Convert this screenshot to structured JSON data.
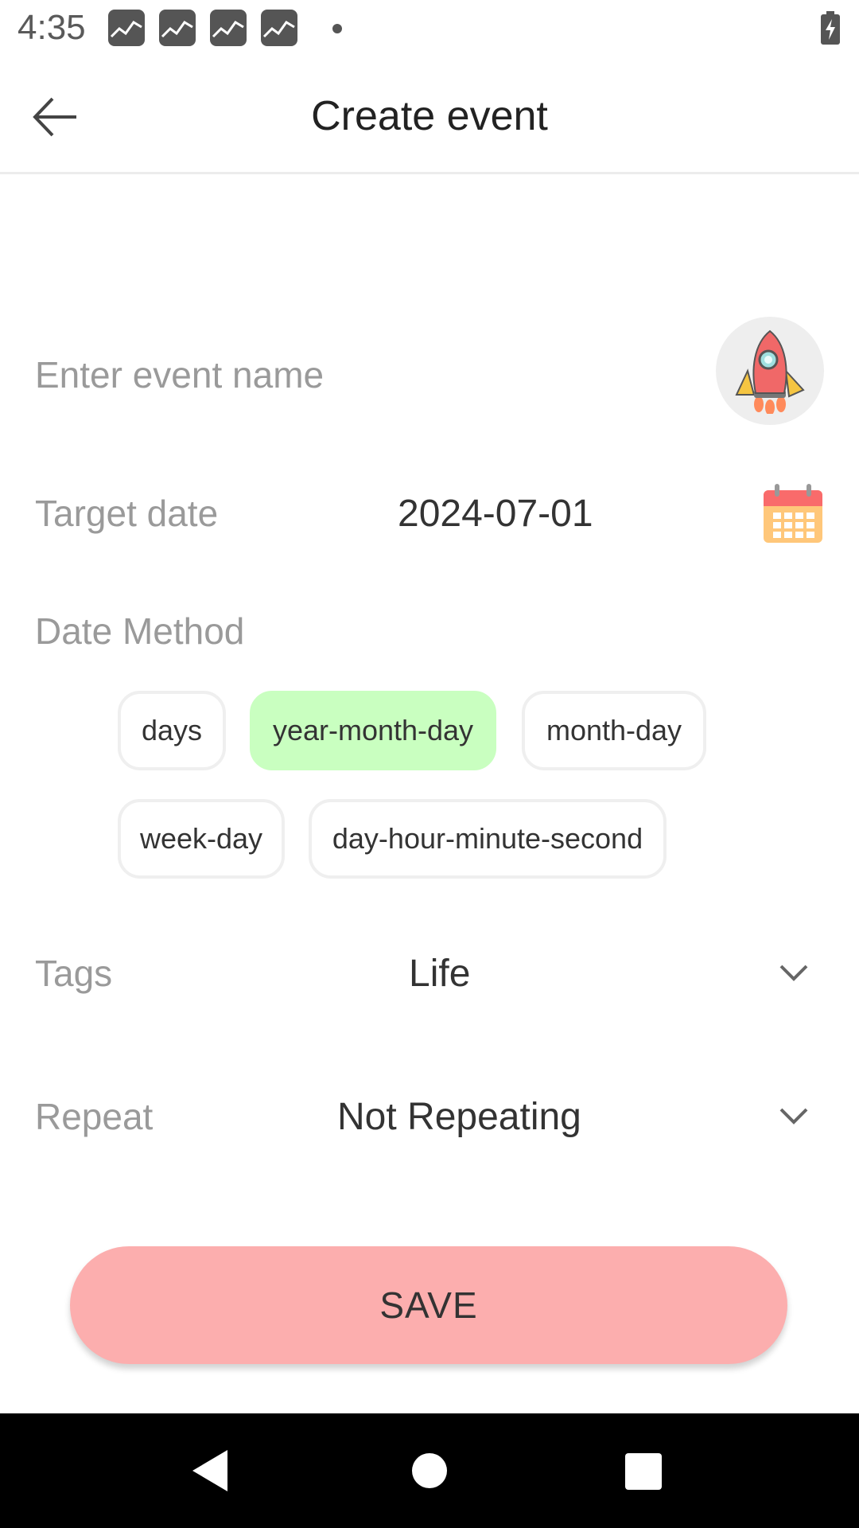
{
  "status_bar": {
    "time": "4:35",
    "notification_icons": [
      "app-notification-icon",
      "app-notification-icon",
      "app-notification-icon",
      "app-notification-icon"
    ],
    "battery_icon": "battery-charging-icon"
  },
  "app_bar": {
    "back_icon": "arrow-left-icon",
    "title": "Create event"
  },
  "form": {
    "event_name": {
      "value": "",
      "placeholder": "Enter event name",
      "icon": "rocket-icon"
    },
    "target_date": {
      "label": "Target date",
      "value": "2024-07-01",
      "icon": "calendar-icon"
    },
    "date_method": {
      "label": "Date Method",
      "options": [
        "days",
        "year-month-day",
        "month-day",
        "week-day",
        "day-hour-minute-second"
      ],
      "selected": "year-month-day"
    },
    "tags": {
      "label": "Tags",
      "value": "Life",
      "icon": "chevron-down-icon"
    },
    "repeat": {
      "label": "Repeat",
      "value": "Not Repeating",
      "icon": "chevron-down-icon"
    }
  },
  "save_button": {
    "label": "SAVE"
  },
  "colors": {
    "selected_chip": "#c9ffc0",
    "save_button": "#fcaeae",
    "calendar_accent": "#f96b6b",
    "calendar_body": "#ffc77a"
  },
  "nav_bar": {
    "back_icon": "nav-back-icon",
    "home_icon": "nav-home-icon",
    "recents_icon": "nav-recents-icon"
  }
}
